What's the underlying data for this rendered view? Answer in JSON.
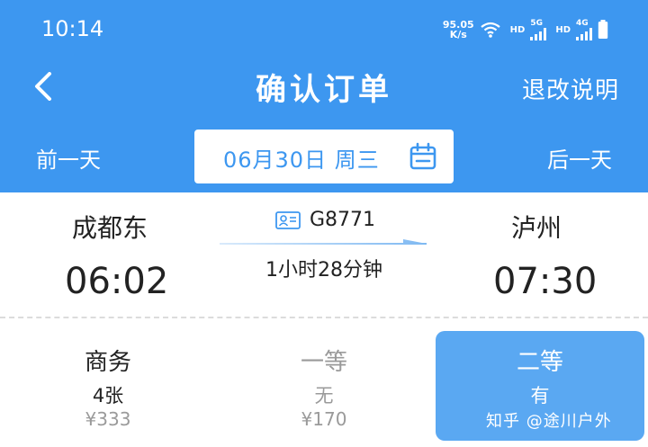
{
  "status_bar": {
    "time": "10:14",
    "net_speed_value": "95.05",
    "net_speed_unit": "K/s",
    "hd_label_1": "HD",
    "network_1": "5G",
    "hd_label_2": "HD",
    "network_2": "4G"
  },
  "header": {
    "title": "确认订单",
    "right_link": "退改说明"
  },
  "date_bar": {
    "prev_label": "前一天",
    "date": "06月30日 周三",
    "next_label": "后一天"
  },
  "trip": {
    "from_station": "成都东",
    "from_time": "06:02",
    "train_no": "G8771",
    "duration": "1小时28分钟",
    "to_station": "泸州",
    "to_time": "07:30"
  },
  "seats": [
    {
      "name": "商务",
      "availability": "4张",
      "price": "¥333"
    },
    {
      "name": "一等",
      "availability": "无",
      "price": "¥170"
    },
    {
      "name": "二等",
      "availability": "有",
      "price": ""
    }
  ],
  "watermark": "知乎 @途川户外",
  "colors": {
    "primary": "#3d97f0",
    "selected_seat": "#5aa8f2",
    "muted": "#9a9a9a"
  }
}
